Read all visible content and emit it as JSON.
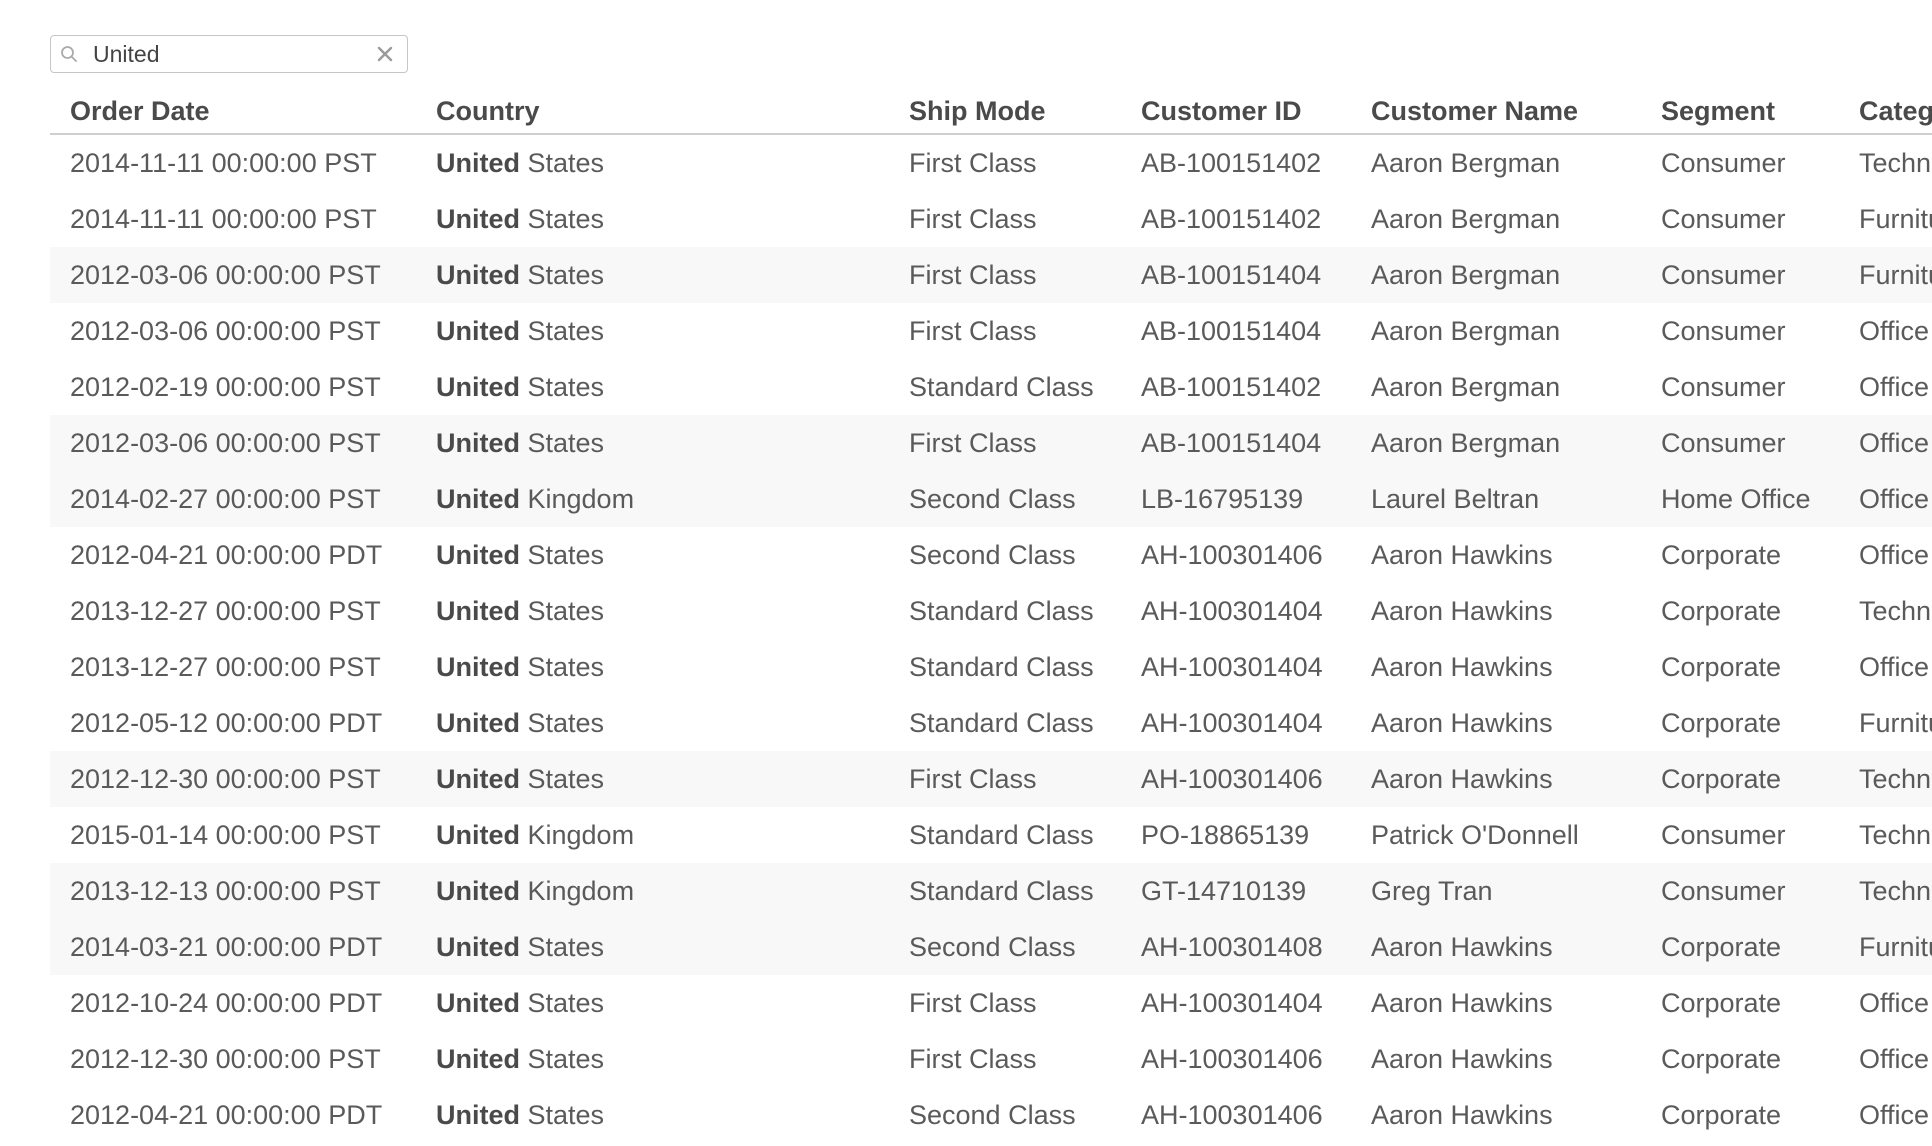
{
  "search": {
    "value": "United",
    "icon": "search-icon",
    "clear_icon": "close-icon"
  },
  "table": {
    "columns": [
      "Order Date",
      "Country",
      "Ship Mode",
      "Customer ID",
      "Customer Name",
      "Segment",
      "Category"
    ],
    "highlight_term": "United",
    "rows": [
      {
        "order_date": "2014-11-11 00:00:00 PST",
        "country_match": "United",
        "country_rest": " States",
        "ship_mode": "First Class",
        "customer_id": "AB-100151402",
        "customer_name": "Aaron Bergman",
        "segment": "Consumer",
        "category": "Technology",
        "striped": false
      },
      {
        "order_date": "2014-11-11 00:00:00 PST",
        "country_match": "United",
        "country_rest": " States",
        "ship_mode": "First Class",
        "customer_id": "AB-100151402",
        "customer_name": "Aaron Bergman",
        "segment": "Consumer",
        "category": "Furniture",
        "striped": false
      },
      {
        "order_date": "2012-03-06 00:00:00 PST",
        "country_match": "United",
        "country_rest": " States",
        "ship_mode": "First Class",
        "customer_id": "AB-100151404",
        "customer_name": "Aaron Bergman",
        "segment": "Consumer",
        "category": "Furniture",
        "striped": true
      },
      {
        "order_date": "2012-03-06 00:00:00 PST",
        "country_match": "United",
        "country_rest": " States",
        "ship_mode": "First Class",
        "customer_id": "AB-100151404",
        "customer_name": "Aaron Bergman",
        "segment": "Consumer",
        "category": "Office Supplies",
        "striped": false
      },
      {
        "order_date": "2012-02-19 00:00:00 PST",
        "country_match": "United",
        "country_rest": " States",
        "ship_mode": "Standard Class",
        "customer_id": "AB-100151402",
        "customer_name": "Aaron Bergman",
        "segment": "Consumer",
        "category": "Office Supplies",
        "striped": false
      },
      {
        "order_date": "2012-03-06 00:00:00 PST",
        "country_match": "United",
        "country_rest": " States",
        "ship_mode": "First Class",
        "customer_id": "AB-100151404",
        "customer_name": "Aaron Bergman",
        "segment": "Consumer",
        "category": "Office Supplies",
        "striped": true
      },
      {
        "order_date": "2014-02-27 00:00:00 PST",
        "country_match": "United",
        "country_rest": " Kingdom",
        "ship_mode": "Second Class",
        "customer_id": "LB-16795139",
        "customer_name": "Laurel Beltran",
        "segment": "Home Office",
        "category": "Office Supplies",
        "striped": true
      },
      {
        "order_date": "2012-04-21 00:00:00 PDT",
        "country_match": "United",
        "country_rest": " States",
        "ship_mode": "Second Class",
        "customer_id": "AH-100301406",
        "customer_name": "Aaron Hawkins",
        "segment": "Corporate",
        "category": "Office Supplies",
        "striped": false
      },
      {
        "order_date": "2013-12-27 00:00:00 PST",
        "country_match": "United",
        "country_rest": " States",
        "ship_mode": "Standard Class",
        "customer_id": "AH-100301404",
        "customer_name": "Aaron Hawkins",
        "segment": "Corporate",
        "category": "Technology",
        "striped": false
      },
      {
        "order_date": "2013-12-27 00:00:00 PST",
        "country_match": "United",
        "country_rest": " States",
        "ship_mode": "Standard Class",
        "customer_id": "AH-100301404",
        "customer_name": "Aaron Hawkins",
        "segment": "Corporate",
        "category": "Office Supplies",
        "striped": false
      },
      {
        "order_date": "2012-05-12 00:00:00 PDT",
        "country_match": "United",
        "country_rest": " States",
        "ship_mode": "Standard Class",
        "customer_id": "AH-100301404",
        "customer_name": "Aaron Hawkins",
        "segment": "Corporate",
        "category": "Furniture",
        "striped": false
      },
      {
        "order_date": "2012-12-30 00:00:00 PST",
        "country_match": "United",
        "country_rest": " States",
        "ship_mode": "First Class",
        "customer_id": "AH-100301406",
        "customer_name": "Aaron Hawkins",
        "segment": "Corporate",
        "category": "Technology",
        "striped": true
      },
      {
        "order_date": "2015-01-14 00:00:00 PST",
        "country_match": "United",
        "country_rest": " Kingdom",
        "ship_mode": "Standard Class",
        "customer_id": "PO-18865139",
        "customer_name": "Patrick O'Donnell",
        "segment": "Consumer",
        "category": "Technology",
        "striped": false
      },
      {
        "order_date": "2013-12-13 00:00:00 PST",
        "country_match": "United",
        "country_rest": " Kingdom",
        "ship_mode": "Standard Class",
        "customer_id": "GT-14710139",
        "customer_name": "Greg Tran",
        "segment": "Consumer",
        "category": "Technology",
        "striped": true
      },
      {
        "order_date": "2014-03-21 00:00:00 PDT",
        "country_match": "United",
        "country_rest": " States",
        "ship_mode": "Second Class",
        "customer_id": "AH-100301408",
        "customer_name": "Aaron Hawkins",
        "segment": "Corporate",
        "category": "Furniture",
        "striped": true
      },
      {
        "order_date": "2012-10-24 00:00:00 PDT",
        "country_match": "United",
        "country_rest": " States",
        "ship_mode": "First Class",
        "customer_id": "AH-100301404",
        "customer_name": "Aaron Hawkins",
        "segment": "Corporate",
        "category": "Office Supplies",
        "striped": false
      },
      {
        "order_date": "2012-12-30 00:00:00 PST",
        "country_match": "United",
        "country_rest": " States",
        "ship_mode": "First Class",
        "customer_id": "AH-100301406",
        "customer_name": "Aaron Hawkins",
        "segment": "Corporate",
        "category": "Office Supplies",
        "striped": false
      },
      {
        "order_date": "2012-04-21 00:00:00 PDT",
        "country_match": "United",
        "country_rest": " States",
        "ship_mode": "Second Class",
        "customer_id": "AH-100301406",
        "customer_name": "Aaron Hawkins",
        "segment": "Corporate",
        "category": "Office Supplies",
        "striped": false
      }
    ]
  }
}
